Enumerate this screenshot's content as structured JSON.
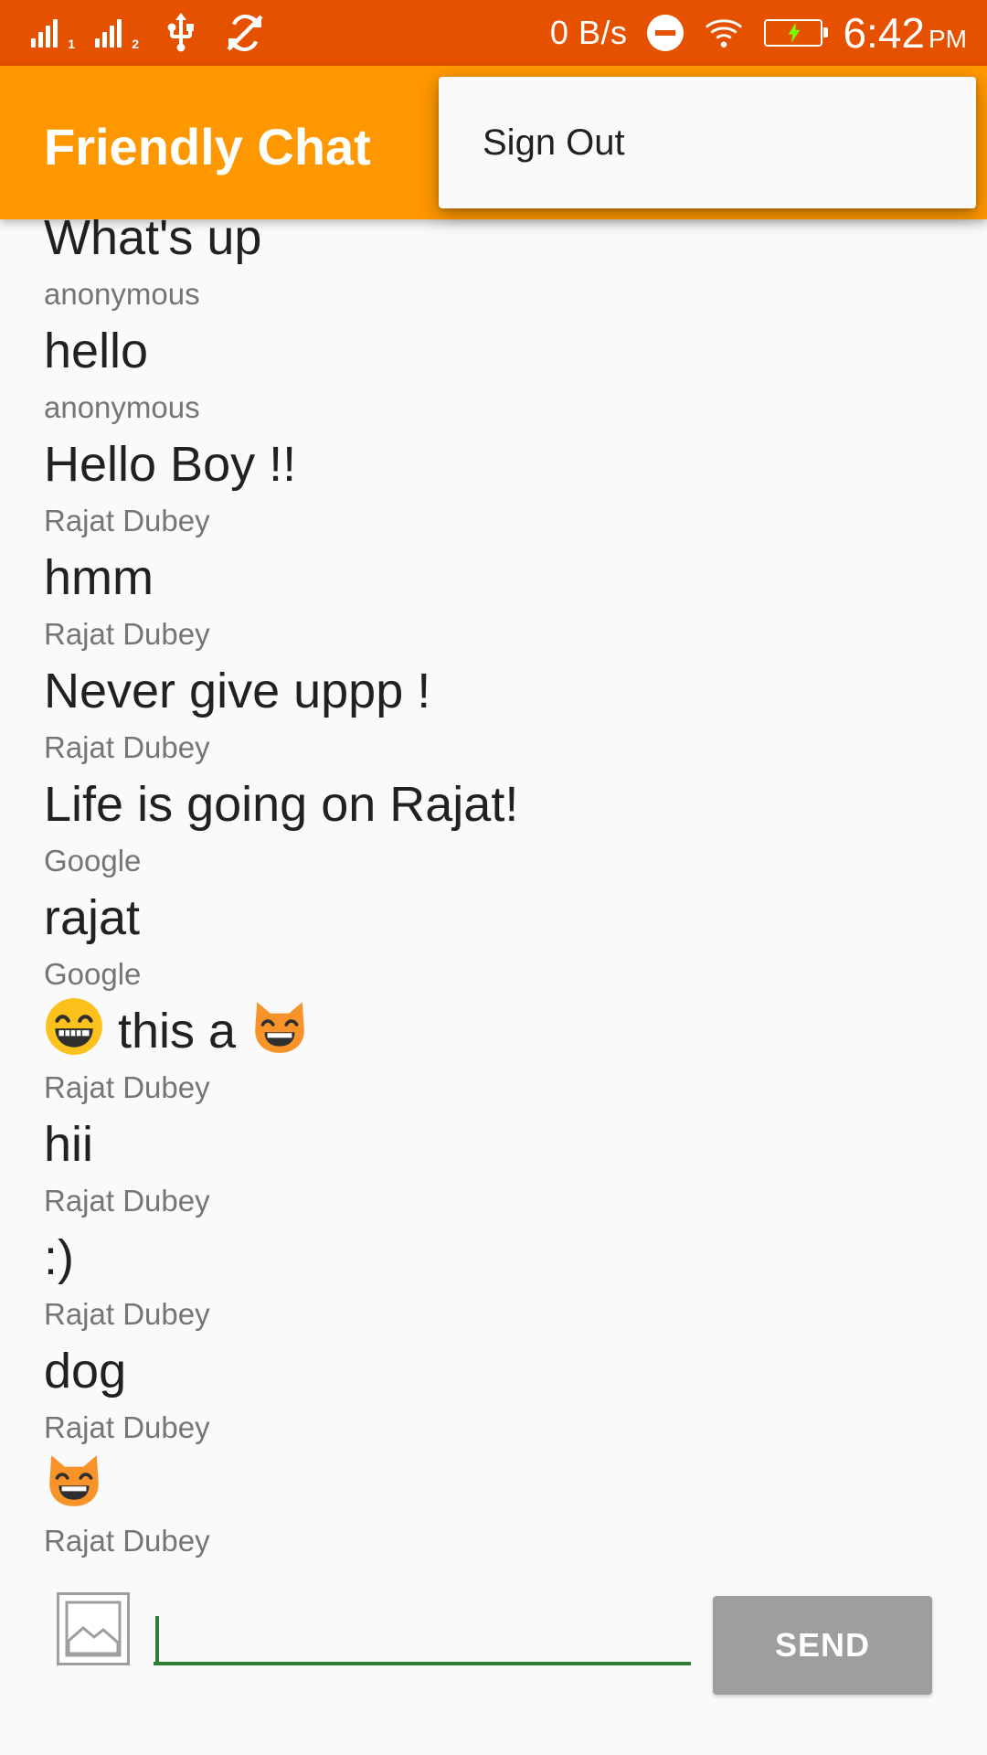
{
  "status_bar": {
    "net_speed": "0 B/s",
    "time": "6:42",
    "ampm": "PM",
    "sim1_label": "1",
    "sim2_label": "2",
    "icons": [
      "signal-sim1-icon",
      "signal-sim2-icon",
      "usb-icon",
      "sync-off-icon",
      "do-not-disturb-icon",
      "wifi-icon",
      "battery-charging-icon"
    ]
  },
  "app_bar": {
    "title": "Friendly Chat",
    "color": "#ff9800"
  },
  "overflow_menu": {
    "items": [
      {
        "label": "Sign Out"
      }
    ]
  },
  "messages": [
    {
      "text": "What's up",
      "name": "anonymous"
    },
    {
      "text": "hello",
      "name": "anonymous"
    },
    {
      "text": "Hello Boy !!",
      "name": "Rajat Dubey"
    },
    {
      "text": "hmm",
      "name": "Rajat Dubey"
    },
    {
      "text": "Never give uppp !",
      "name": "Rajat Dubey"
    },
    {
      "text": "Life is going on Rajat!",
      "name": "Google"
    },
    {
      "text": "rajat",
      "name": "Google"
    },
    {
      "text": "this a",
      "name": "Rajat Dubey",
      "emoji_before": "grinning-face-emoji",
      "emoji_after": "grinning-cat-emoji"
    },
    {
      "text": "hii",
      "name": "Rajat Dubey"
    },
    {
      "text": ":)",
      "name": "Rajat Dubey"
    },
    {
      "text": "dog",
      "name": "Rajat Dubey"
    },
    {
      "text": "",
      "name": "Rajat Dubey",
      "emoji_after": "grinning-cat-emoji"
    }
  ],
  "input_bar": {
    "message_value": "",
    "send_label": "SEND",
    "photo_icon": "image-icon"
  },
  "colors": {
    "status_bar": "#e65100",
    "accent_underline": "#2e7d32",
    "send_button": "#9e9e9e"
  }
}
